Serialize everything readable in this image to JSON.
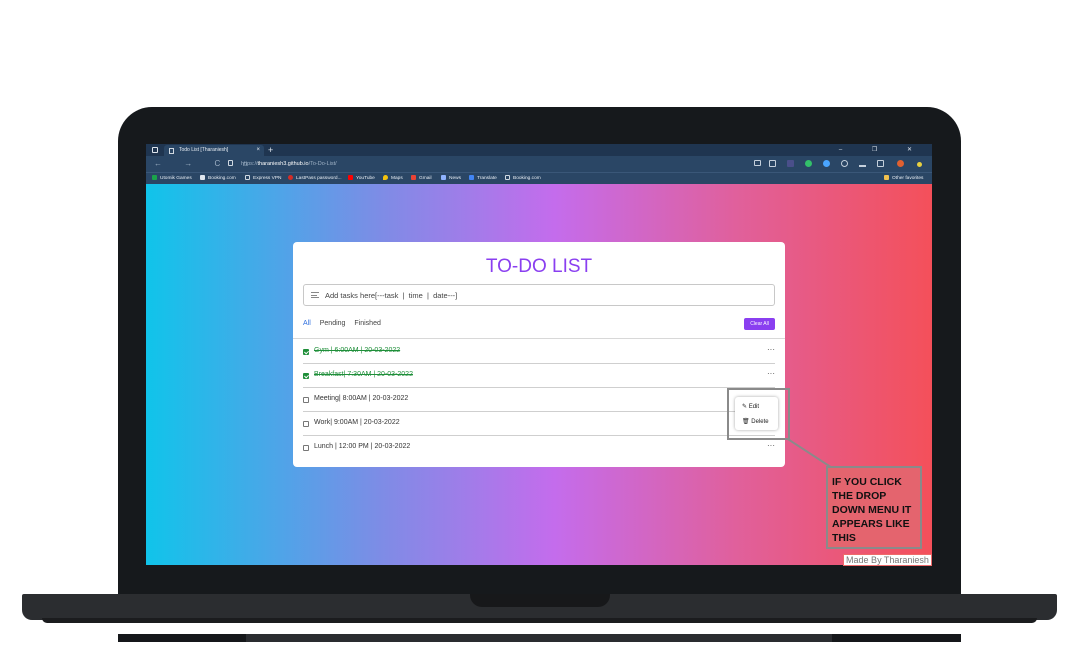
{
  "browser": {
    "tab_title": "Todo List [Tharaniesh]",
    "tab_close": "×",
    "new_tab": "+",
    "window_controls": "–  ❐  ✕",
    "nav_buttons": "←  →  C  ⌂",
    "url_prefix": "https://",
    "url_host": "tharaniesh3.github.io",
    "url_path": "/To-Do-List/",
    "bookmarks": [
      {
        "label": "Utomik Games",
        "icon": "utomik-icon",
        "color": "#1aa34a"
      },
      {
        "label": "Booking.com",
        "icon": "booking-icon",
        "color": "#1d3b8f"
      },
      {
        "label": "Express VPN",
        "icon": "page-icon",
        "color": "#cfd8e1"
      },
      {
        "label": "LastPass password...",
        "icon": "lastpass-icon",
        "color": "#d32d27"
      },
      {
        "label": "YouTube",
        "icon": "youtube-icon",
        "color": "#ff0000"
      },
      {
        "label": "Maps",
        "icon": "maps-icon",
        "color": "#34a853"
      },
      {
        "label": "Gmail",
        "icon": "gmail-icon",
        "color": "#ea4335"
      },
      {
        "label": "News",
        "icon": "news-icon",
        "color": "#4285f4"
      },
      {
        "label": "Translate",
        "icon": "translate-icon",
        "color": "#4285f4"
      },
      {
        "label": "Booking.com",
        "icon": "page-icon",
        "color": "#cfd8e1"
      }
    ],
    "other_favorites": "Other favorites"
  },
  "app": {
    "title": "TO-DO LIST",
    "input_placeholder": "Add tasks here[---task  |  time  |  date---]",
    "filters": [
      "All",
      "Pending",
      "Finished"
    ],
    "clear_all": "Clear All",
    "tasks": [
      {
        "label": "Gym | 6:00AM | 20-03-2022",
        "done": true
      },
      {
        "label": "Breakfast| 7:30AM | 20-03-2022",
        "done": true
      },
      {
        "label": "Meeting| 8:00AM | 20-03-2022",
        "done": false
      },
      {
        "label": "Work| 9:00AM | 20-03-2022",
        "done": false
      },
      {
        "label": "Lunch | 12:00 PM | 20-03-2022",
        "done": false
      }
    ],
    "task_menu": "···",
    "dropdown": {
      "edit": "Edit",
      "delete": "Delete"
    }
  },
  "annotation": {
    "callout_text": "IF YOU CLICK THE DROP DOWN MENU IT APPEARS LIKE THIS",
    "signature": "Made By Tharaniesh"
  },
  "colors": {
    "accent": "#8a3ff0",
    "done": "#1f8f3a",
    "callout_bg": "#e4646e"
  }
}
